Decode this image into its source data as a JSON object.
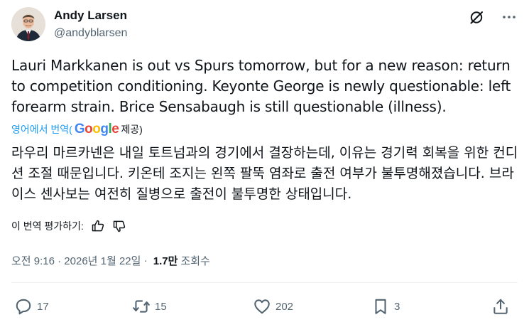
{
  "author": {
    "display_name": "Andy Larsen",
    "handle": "@andyblarsen"
  },
  "header_icons": [
    "grok-icon",
    "more-icon"
  ],
  "tweet": {
    "text": "Lauri Markkanen is out vs Spurs tomorrow, but for a new reason: return to competition conditioning. Keyonte George is newly questionable: left forearm strain. Brice Sensabaugh is still questionable (illness)."
  },
  "translation": {
    "translate_label": "영어에서 번역(",
    "provider_close": " 제공)",
    "translated_text": "라우리 마르카넨은 내일 토트넘과의 경기에서 결장하는데, 이유는 경기력 회복을 위한 컨디션 조절 때문입니다. 키온테 조지는 왼쪽 팔뚝 염좌로 출전 여부가 불투명해졌습니다. 브라이스 센사보는 여전히 질병으로 출전이 불투명한 상태입니다.",
    "rate_label": "이 번역 평가하기:"
  },
  "meta": {
    "timestamp": "오전 9:16 · 2026년 1월 22일",
    "separator": " · ",
    "views_count": "1.7만",
    "views_label": "조회수"
  },
  "actions": {
    "replies": "17",
    "reposts": "15",
    "likes": "202",
    "bookmarks": "3"
  }
}
